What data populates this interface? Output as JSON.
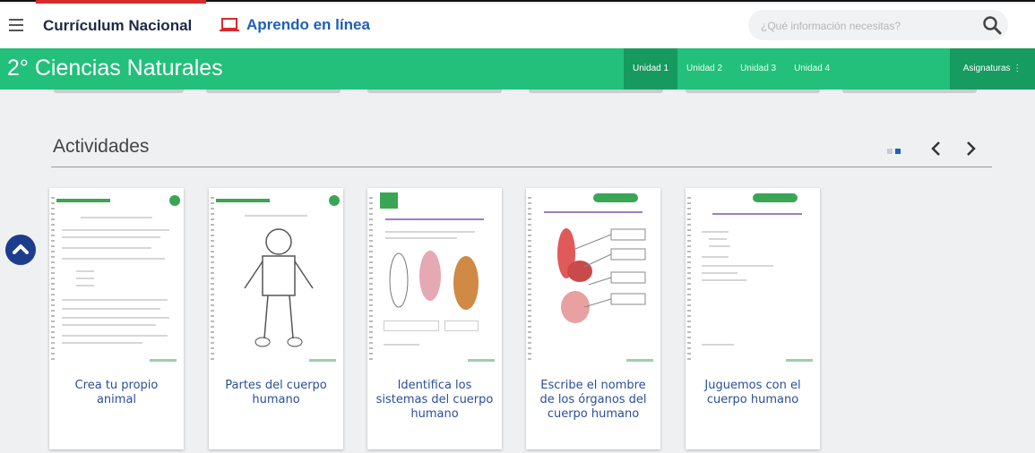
{
  "header": {
    "brand": "Currículum Nacional",
    "aprendo_label": "Aprendo en línea",
    "search_placeholder": "¿Qué información necesitas?"
  },
  "course": {
    "title": "2° Ciencias Naturales",
    "units": [
      "Unidad 1",
      "Unidad 2",
      "Unidad 3",
      "Unidad 4"
    ],
    "active_unit": "Unidad 1",
    "asignaturas_label": "Asignaturas"
  },
  "activities": {
    "title": "Actividades",
    "cards": [
      {
        "caption": "Crea tu propio animal"
      },
      {
        "caption": "Partes del cuerpo humano"
      },
      {
        "caption": "Identifica los sistemas del cuerpo humano"
      },
      {
        "caption": "Escribe el nombre de los órganos del cuerpo humano"
      },
      {
        "caption": "Juguemos con el cuerpo humano"
      }
    ]
  },
  "colors": {
    "green_bar": "#22c07a",
    "active_unit_bg": "#179a5f",
    "brand_blue": "#1f5fb8",
    "scroll_button": "#1c3c8c"
  },
  "icons": {
    "menu": "hamburger-menu-icon",
    "aprendo": "laptop-icon",
    "search": "search-icon",
    "prev": "chevron-left-icon",
    "next": "chevron-right-icon",
    "scroll_top": "chevron-up-icon"
  }
}
